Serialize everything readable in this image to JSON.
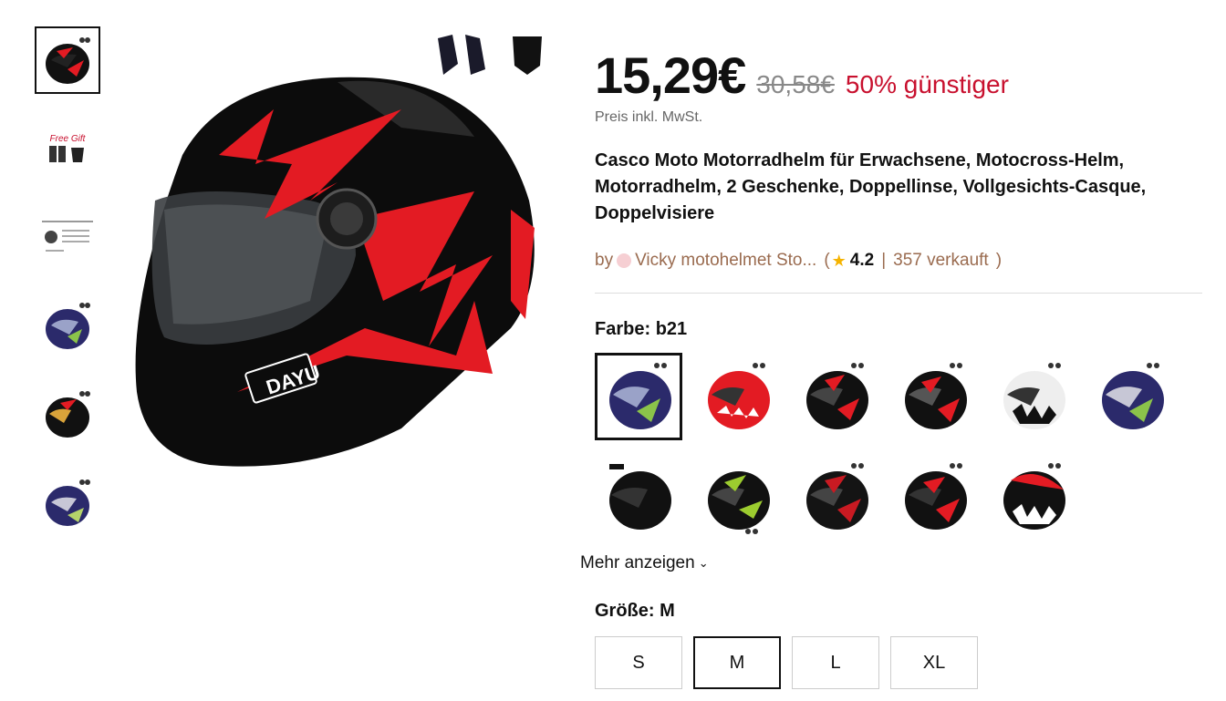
{
  "price": {
    "current": "15,29€",
    "original": "30,58€",
    "discount": "50% günstiger",
    "tax_note": "Preis inkl. MwSt."
  },
  "product": {
    "title": "Casco Moto Motorradhelm für Erwachsene, Motocross-Helm, Motorradhelm, 2 Geschenke, Doppellinse, Vollgesichts-Casque, Doppelvisiere"
  },
  "seller": {
    "by": "by",
    "name": "Vicky motohelmet Sto...",
    "open_paren": "(",
    "rating": "4.2",
    "separator": "|",
    "sold": "357 verkauft",
    "close_paren": ")"
  },
  "color": {
    "label": "Farbe:",
    "selected": "b21",
    "more": "Mehr anzeigen"
  },
  "size": {
    "label": "Größe:",
    "selected": "M",
    "options": [
      "S",
      "M",
      "L",
      "XL"
    ]
  },
  "gallery": {
    "thumb_text": "Free Gift"
  },
  "colors": {
    "accent_red": "#c8102e",
    "seller_brown": "#9a6b4f",
    "star": "#f5b300"
  }
}
